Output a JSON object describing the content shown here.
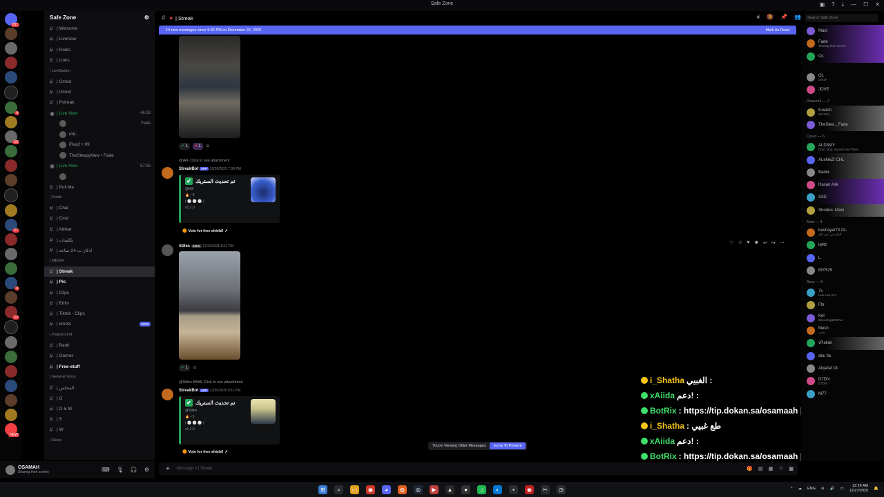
{
  "window": {
    "title": "Safe Zone"
  },
  "server_badges": [
    "237",
    "4",
    "13",
    "17",
    "4",
    "12",
    "NEW"
  ],
  "guild": {
    "name": "Safe Zone"
  },
  "channels": [
    {
      "type": "ch",
      "label": "| Welcome"
    },
    {
      "type": "ch",
      "label": "| LiveNow"
    },
    {
      "type": "ch",
      "label": "| Roles"
    },
    {
      "type": "ch",
      "label": "| Links"
    },
    {
      "type": "cat",
      "label": "| LiveStation"
    },
    {
      "type": "ch",
      "label": "| Cmod"
    },
    {
      "type": "ch",
      "label": "| Umod"
    },
    {
      "type": "ch",
      "label": "| Pstreak"
    },
    {
      "type": "live",
      "label": "| Live Now",
      "right": "46:33"
    },
    {
      "type": "sub",
      "label": "",
      "right": "Fade"
    },
    {
      "type": "sub",
      "label": "iAll-"
    },
    {
      "type": "sub",
      "label": "iRay2 • 99"
    },
    {
      "type": "sub",
      "label": "TheSleepyNew • Fade"
    },
    {
      "type": "live",
      "label": "| Live Now",
      "right": "57:05"
    },
    {
      "type": "sub",
      "label": ""
    },
    {
      "type": "ch",
      "label": "| Pull Me"
    },
    {
      "type": "cat",
      "label": "| Public"
    },
    {
      "type": "ch",
      "label": "| Chat"
    },
    {
      "type": "ch",
      "label": "| Cmd"
    },
    {
      "type": "ch",
      "label": "| Athkar"
    },
    {
      "type": "ch",
      "label": "| تكليفات"
    },
    {
      "type": "ch",
      "label": "| اذكار-ت-24-ساعه"
    },
    {
      "type": "cat",
      "label": "| MEDIA"
    },
    {
      "type": "active",
      "label": "| Streak"
    },
    {
      "type": "bold",
      "label": "| Pic"
    },
    {
      "type": "ch",
      "label": "| Clips"
    },
    {
      "type": "ch",
      "label": "| Edits"
    },
    {
      "type": "ch",
      "label": "| Tiktok - Clips"
    },
    {
      "type": "ch",
      "label": "| emots",
      "badge": "NEW"
    },
    {
      "type": "cat",
      "label": "| PlayGround"
    },
    {
      "type": "ch",
      "label": "| Bank"
    },
    {
      "type": "ch",
      "label": "| Games"
    },
    {
      "type": "bold",
      "label": "| Free-stuff"
    },
    {
      "type": "cat",
      "label": "| General Voice"
    },
    {
      "type": "ch",
      "label": "| المجلس"
    },
    {
      "type": "ch",
      "label": "| G"
    },
    {
      "type": "ch",
      "label": "| O & M"
    },
    {
      "type": "ch",
      "label": "| S"
    },
    {
      "type": "ch",
      "label": "| W"
    },
    {
      "type": "cat",
      "label": "| Sleep"
    }
  ],
  "user": {
    "name": "OSAMAH",
    "status": "Sharing their screen"
  },
  "header": {
    "channel": "| Streak"
  },
  "search": {
    "placeholder": "Search Safe Zone"
  },
  "banner": {
    "text": "14 new messages since 9:32 PM on December 26, 2025",
    "action": "Mark As Read"
  },
  "messages": {
    "r1": {
      "one": "1",
      "two": "1"
    },
    "m1": {
      "reply": "@iAll-  Click to see attachment",
      "name": "StreakBot",
      "app": "APP",
      "time": "12/26/2025 7:30 PM",
      "title": "تم تحديث الستريك",
      "mention": "@iAll-",
      "l1": "5",
      "l2": "( ⚪ ⚪ ⚪ )",
      "ver": "v1.1.0",
      "vote": "Vote for free shield!"
    },
    "m2": {
      "name": "Stiles",
      "tag": "BMW",
      "time": "12/26/2025 8:11 PM",
      "react": "1"
    },
    "m3": {
      "reply": "@Stiles  BMW  Click to see attachment",
      "name": "StreakBot",
      "app": "APP",
      "time": "12/26/2025 8:11 PM",
      "title": "تم تحديث الستريك",
      "mention": "@Stiles",
      "l1": "5",
      "l2": "( ⚪ ⚪ ⚪ )",
      "ver": "v1.1.0",
      "vote": "Vote for free shield!"
    }
  },
  "overlay_chat": [
    {
      "name": "i_Shatha",
      "msg": "الغبيي :",
      "color": "#f5c518"
    },
    {
      "name": "xAiida",
      "msg": "دعم! :",
      "color": "#3ee06b"
    },
    {
      "name": "BotRix",
      "msg": ": https://tip.dokan.sa/osamaah | دكان تب | https:/",
      "color": "#3ee06b"
    },
    {
      "name": "i_Shatha",
      "msg": ": طع غبيي",
      "color": "#f5c518"
    },
    {
      "name": "xAiida",
      "msg": "دعم! :",
      "color": "#3ee06b"
    },
    {
      "name": "BotRix",
      "msg": ": https://tip.dokan.sa/osamaah | دكان تب | https:/",
      "color": "#3ee06b"
    }
  ],
  "older": {
    "text": "You're Viewing Older Messages",
    "jump": "Jump To Present"
  },
  "composer": {
    "placeholder": "Message # | Streak"
  },
  "members": [
    {
      "type": "m",
      "name": "Mast",
      "style": "boost"
    },
    {
      "type": "m",
      "name": "Fade",
      "sub": "Sharing their screen",
      "style": "boost"
    },
    {
      "type": "m",
      "name": "OL",
      "style": "boost"
    },
    {
      "type": "gap"
    },
    {
      "type": "m",
      "name": "OL",
      "sub": "GTOF"
    },
    {
      "type": "m",
      "name": "JOVE"
    },
    {
      "type": "cat",
      "label": "Peaceful — 2"
    },
    {
      "type": "m",
      "name": "8.wash",
      "sub": "24 NOV",
      "style": "gray"
    },
    {
      "type": "m",
      "name": "TheSlee... Fade",
      "style": "gray"
    },
    {
      "type": "cat",
      "label": "Cloud — 6"
    },
    {
      "type": "m",
      "name": "ALD3MY",
      "sub": "Don't stop, success isn't that..."
    },
    {
      "type": "m",
      "name": "ALeNeZI CHL",
      "style": "gray"
    },
    {
      "type": "m",
      "name": "Bader.",
      "style": "gray"
    },
    {
      "type": "m",
      "name": "Hasan  Ask",
      "style": "boost"
    },
    {
      "type": "m",
      "name": "S3D",
      "style": "boost"
    },
    {
      "type": "m",
      "name": "Shodoo.  Mast",
      "style": "gray"
    },
    {
      "type": "cat",
      "label": "Mod — 4"
    },
    {
      "type": "m",
      "name": "bashayer70 OL",
      "sub": "الذكر في عمر الله"
    },
    {
      "type": "m",
      "name": "iq4lz"
    },
    {
      "type": "m",
      "name": "L"
    },
    {
      "type": "m",
      "name": "MYR25"
    },
    {
      "type": "cat",
      "label": "Aura — 8"
    },
    {
      "type": "m",
      "name": "7s",
      "sub": "Live kick o7s"
    },
    {
      "type": "m",
      "name": "Ftlr"
    },
    {
      "type": "m",
      "name": "Kel",
      "sub": "discord.gg/MXAU"
    },
    {
      "type": "m",
      "name": "Mesh",
      "sub": "متعب"
    },
    {
      "type": "m",
      "name": "vRakan",
      "style": "gray"
    },
    {
      "type": "m",
      "name": "abu tla"
    },
    {
      "type": "m",
      "name": "Alqallaf OL"
    },
    {
      "type": "m",
      "name": "D7DN",
      "sub": "D7DN"
    },
    {
      "type": "m",
      "name": "M77"
    }
  ],
  "tray": {
    "lang": "ENG",
    "time": "12:26 AM",
    "date": "12/27/2025"
  }
}
